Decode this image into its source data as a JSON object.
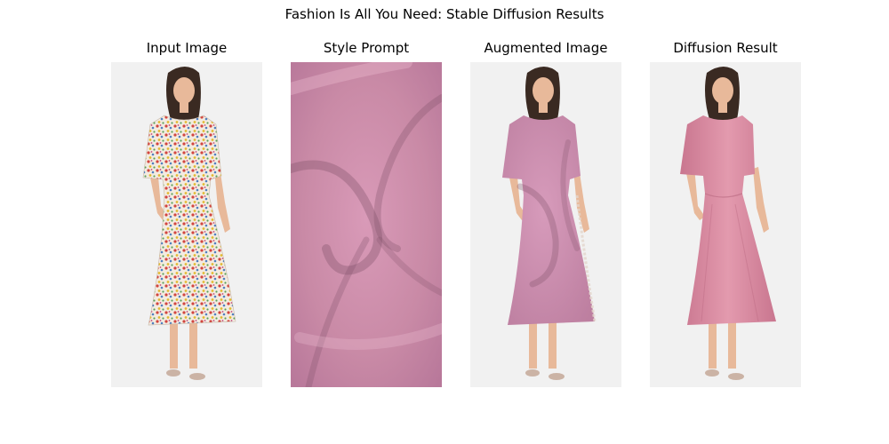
{
  "figure": {
    "title": "Fashion Is All You Need: Stable Diffusion Results"
  },
  "panels": [
    {
      "title": "Input Image",
      "content": "model-floral-dress"
    },
    {
      "title": "Style Prompt",
      "content": "pink-fabric-swirl"
    },
    {
      "title": "Augmented Image",
      "content": "model-texture-mapped-dress"
    },
    {
      "title": "Diffusion Result",
      "content": "model-pink-dress"
    }
  ],
  "colors": {
    "panel_background": "#f1f1f1",
    "fabric_pink": "#c98aa6",
    "dress_pink": "#d6879e",
    "hair": "#3a2a22",
    "skin": "#e8b99a"
  }
}
